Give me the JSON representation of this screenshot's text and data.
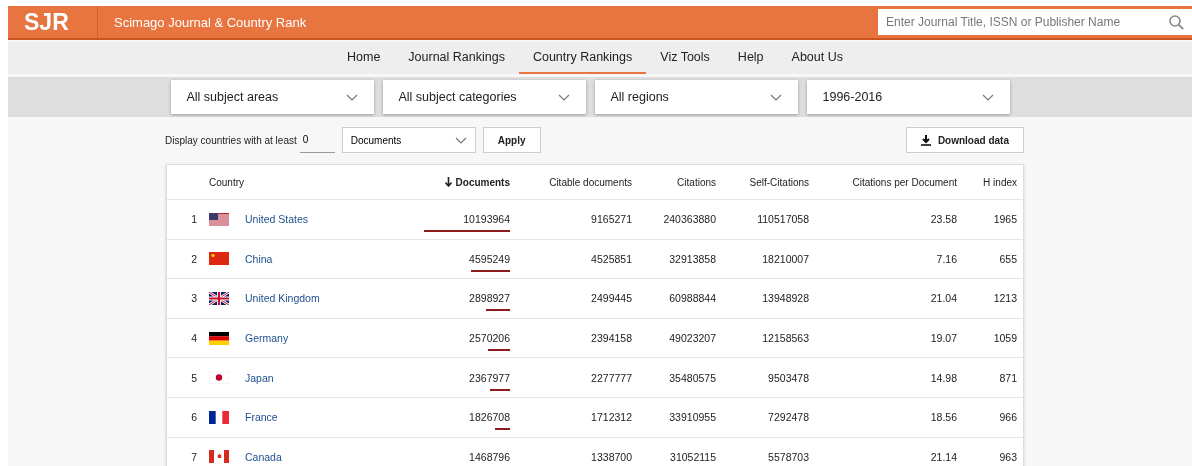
{
  "header": {
    "logo": "SJR",
    "site_title": "Scimago Journal & Country Rank",
    "search": {
      "placeholder": "Enter Journal Title, ISSN or Publisher Name"
    }
  },
  "nav": [
    {
      "label": "Home",
      "selected": false
    },
    {
      "label": "Journal Rankings",
      "selected": false
    },
    {
      "label": "Country Rankings",
      "selected": true
    },
    {
      "label": "Viz Tools",
      "selected": false
    },
    {
      "label": "Help",
      "selected": false
    },
    {
      "label": "About Us",
      "selected": false
    }
  ],
  "filters": [
    {
      "value": "All subject areas"
    },
    {
      "value": "All subject categories"
    },
    {
      "value": "All regions"
    },
    {
      "value": "1996-2016"
    }
  ],
  "display_filter": {
    "label": "Display countries with at least",
    "minimum": "0",
    "metric": "Documents",
    "apply": "Apply"
  },
  "download": "Download data",
  "table": {
    "columns": [
      {
        "label": "Country",
        "sorted": false
      },
      {
        "label": "Documents",
        "sorted": true
      },
      {
        "label": "Citable documents",
        "sorted": false
      },
      {
        "label": "Citations",
        "sorted": false
      },
      {
        "label": "Self-Citations",
        "sorted": false
      },
      {
        "label": "Citations per Document",
        "sorted": false
      },
      {
        "label": "H index",
        "sorted": false
      }
    ],
    "rows": [
      {
        "rank": "1",
        "kind": "us",
        "country": "United States",
        "documents": "10193964",
        "citable": "9165271",
        "citations": "240363880",
        "self_citations": "110517058",
        "cpd": "23.58",
        "h_index": "1965"
      },
      {
        "rank": "2",
        "kind": "cn",
        "country": "China",
        "documents": "4595249",
        "citable": "4525851",
        "citations": "32913858",
        "self_citations": "18210007",
        "cpd": "7.16",
        "h_index": "655"
      },
      {
        "rank": "3",
        "kind": "gb",
        "country": "United Kingdom",
        "documents": "2898927",
        "citable": "2499445",
        "citations": "60988844",
        "self_citations": "13948928",
        "cpd": "21.04",
        "h_index": "1213"
      },
      {
        "rank": "4",
        "kind": "de",
        "country": "Germany",
        "documents": "2570206",
        "citable": "2394158",
        "citations": "49023207",
        "self_citations": "12158563",
        "cpd": "19.07",
        "h_index": "1059"
      },
      {
        "rank": "5",
        "kind": "jp",
        "country": "Japan",
        "documents": "2367977",
        "citable": "2277777",
        "citations": "35480575",
        "self_citations": "9503478",
        "cpd": "14.98",
        "h_index": "871"
      },
      {
        "rank": "6",
        "kind": "fr",
        "country": "France",
        "documents": "1826708",
        "citable": "1712312",
        "citations": "33910955",
        "self_citations": "7292478",
        "cpd": "18.56",
        "h_index": "966"
      },
      {
        "rank": "7",
        "kind": "ca",
        "country": "Canada",
        "documents": "1468796",
        "citable": "1338700",
        "citations": "31052115",
        "self_citations": "5578703",
        "cpd": "21.14",
        "h_index": "963"
      }
    ]
  }
}
